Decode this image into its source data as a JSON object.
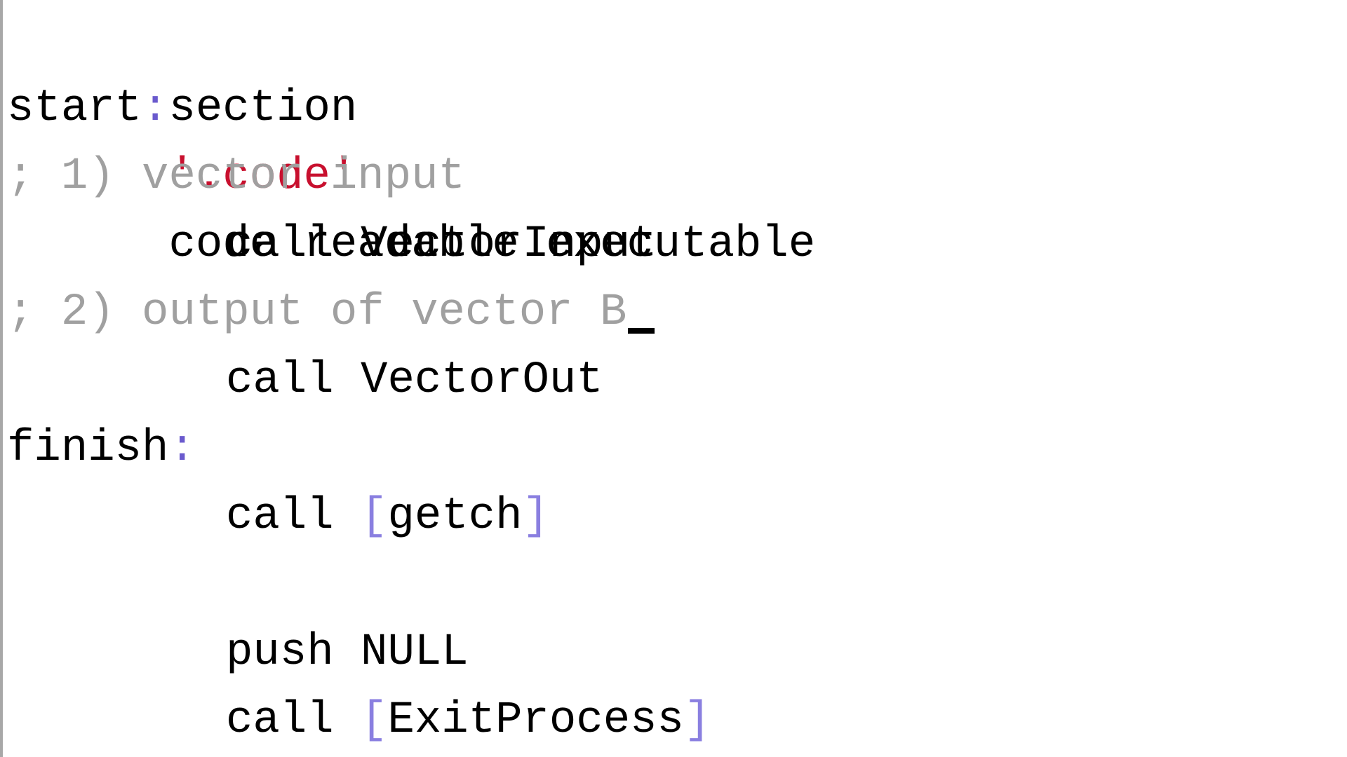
{
  "lines": [
    {
      "kind": "section",
      "parts": [
        "section",
        "'.code'",
        "code readable executable"
      ]
    },
    {
      "kind": "label",
      "name": "start",
      "colon": ":"
    },
    {
      "kind": "comment",
      "text": "; 1) vector input"
    },
    {
      "kind": "instr",
      "op": "call",
      "arg": "VectorInput"
    },
    {
      "kind": "comment",
      "text": "; 2) output of vector B"
    },
    {
      "kind": "instr",
      "op": "call",
      "arg": "VectorOut"
    },
    {
      "kind": "label",
      "name": "finish",
      "colon": ":"
    },
    {
      "kind": "instr-bracket",
      "op": "call",
      "open": "[",
      "arg": "getch",
      "close": "]"
    },
    {
      "kind": "blank"
    },
    {
      "kind": "instr",
      "op": "push",
      "arg": "NULL"
    },
    {
      "kind": "instr-bracket",
      "op": "call",
      "open": "[",
      "arg": "ExitProcess",
      "close": "]"
    }
  ],
  "colors": {
    "string": "#c8102e",
    "comment": "#a0a0a0",
    "punctuation": "#6a5acd",
    "bracket": "#8a7fe0"
  }
}
